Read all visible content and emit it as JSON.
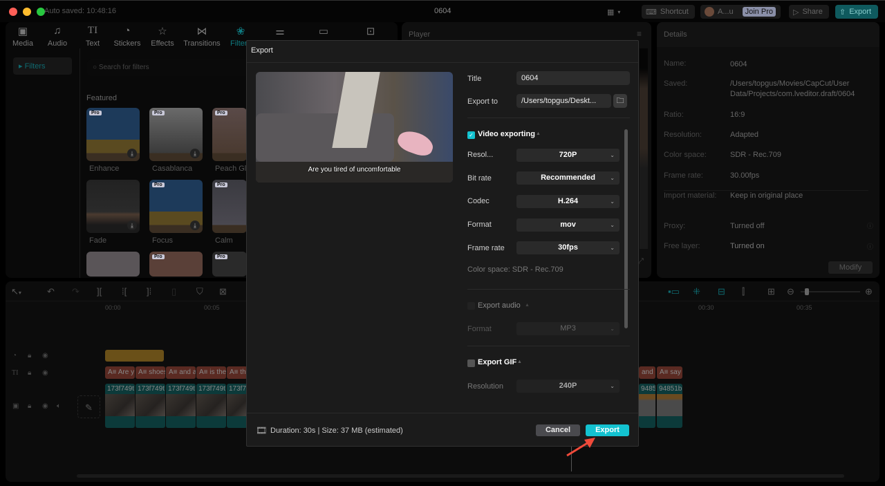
{
  "window": {
    "title": "0604",
    "autosave": "Auto saved: 10:48:16"
  },
  "topbar": {
    "shortcut_label": "Shortcut",
    "user_label": "A...u",
    "join_pro_label": "Join Pro",
    "share_label": "Share",
    "export_label": "Export"
  },
  "toolbar": {
    "items": [
      {
        "label": "Media",
        "icon": "media-icon"
      },
      {
        "label": "Audio",
        "icon": "audio-icon"
      },
      {
        "label": "Text",
        "icon": "text-icon"
      },
      {
        "label": "Stickers",
        "icon": "stickers-icon"
      },
      {
        "label": "Effects",
        "icon": "effects-icon"
      },
      {
        "label": "Transitions",
        "icon": "transitions-icon"
      },
      {
        "label": "Filters",
        "icon": "filters-icon",
        "active": true
      },
      {
        "label": "",
        "icon": "adjustment-icon"
      },
      {
        "label": "",
        "icon": "templates-icon"
      },
      {
        "label": "",
        "icon": "avatar-icon"
      }
    ]
  },
  "filters": {
    "sidebar_item": "Filters",
    "search_placeholder": "Search for filters",
    "section": "Featured",
    "items": [
      {
        "label": "Enhance",
        "pro": true
      },
      {
        "label": "Casablanca",
        "pro": true
      },
      {
        "label": "Peach Gl",
        "pro": true
      },
      {
        "label": "Fade",
        "pro": false
      },
      {
        "label": "Focus",
        "pro": true
      },
      {
        "label": "Calm",
        "pro": true
      },
      {
        "label": "",
        "pro": false
      },
      {
        "label": "",
        "pro": true
      },
      {
        "label": "",
        "pro": true
      }
    ],
    "pro_badge": "Pro"
  },
  "player": {
    "title": "Player"
  },
  "details": {
    "title": "Details",
    "rows": [
      {
        "key": "Name:",
        "value": "0604"
      },
      {
        "key": "Saved:",
        "value": "/Users/topgus/Movies/CapCut/User Data/Projects/com.lveditor.draft/0604"
      },
      {
        "key": "Ratio:",
        "value": "16:9"
      },
      {
        "key": "Resolution:",
        "value": "Adapted"
      },
      {
        "key": "Color space:",
        "value": "SDR - Rec.709"
      },
      {
        "key": "Frame rate:",
        "value": "30.00fps"
      },
      {
        "key": "Import material:",
        "value": "Keep in original place"
      },
      {
        "key": "Proxy:",
        "value": "Turned off"
      },
      {
        "key": "Free layer:",
        "value": "Turned on"
      }
    ],
    "modify_label": "Modify"
  },
  "export_dialog": {
    "title": "Export",
    "preview_caption": "Are you tired of uncomfortable",
    "title_label": "Title",
    "title_value": "0604",
    "export_to_label": "Export to",
    "export_to_value": "/Users/topgus/Deskt...",
    "video": {
      "label": "Video exporting",
      "checked": true,
      "fields": [
        {
          "label": "Resol...",
          "value": "720P"
        },
        {
          "label": "Bit rate",
          "value": "Recommended"
        },
        {
          "label": "Codec",
          "value": "H.264"
        },
        {
          "label": "Format",
          "value": "mov"
        },
        {
          "label": "Frame rate",
          "value": "30fps"
        }
      ],
      "color_space": "Color space: SDR - Rec.709"
    },
    "audio": {
      "label": "Export audio",
      "checked": false,
      "format_label": "Format",
      "format_value": "MP3"
    },
    "gif": {
      "label": "Export GIF",
      "checked": false,
      "resolution_label": "Resolution",
      "resolution_value": "240P"
    },
    "footer_info": "Duration: 30s | Size: 37 MB (estimated)",
    "cancel_label": "Cancel",
    "export_label": "Export",
    "accent": "#13c2d0"
  },
  "timeline": {
    "ticks": [
      "00:00",
      "00:05",
      "00:30",
      "00:35"
    ],
    "text_clips": [
      "Are y",
      "shoes",
      "and a",
      "is the",
      "th",
      "and",
      "say"
    ],
    "video_clips": [
      "173f749t",
      "173f749t",
      "173f749t",
      "173f749t",
      "173f7",
      "94851b",
      "94851b"
    ]
  }
}
